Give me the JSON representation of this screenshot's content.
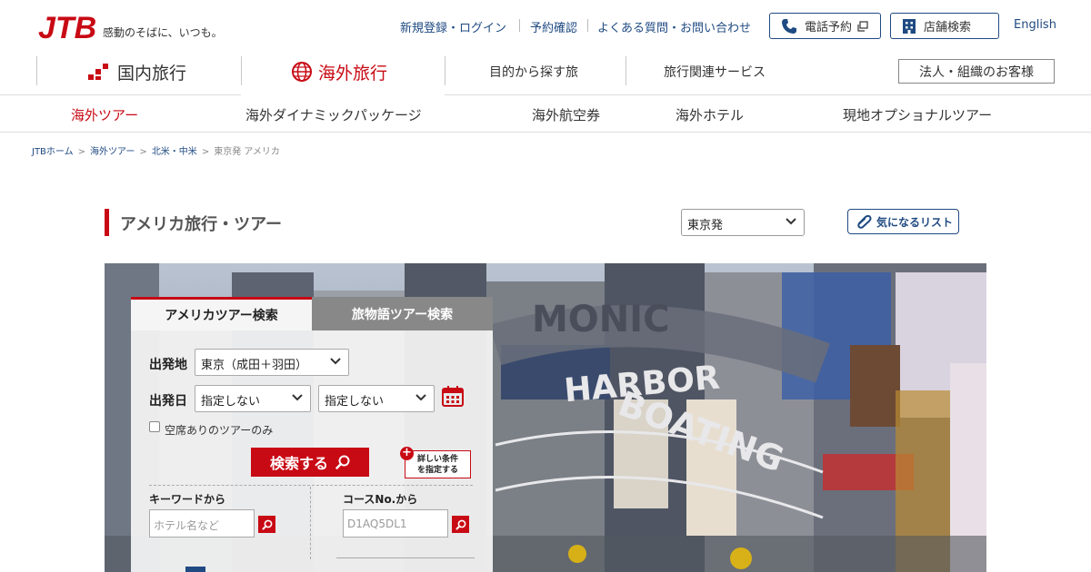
{
  "header": {
    "logo_text": "JTB",
    "tagline": "感動のそばに、いつも。",
    "links": [
      "新規登録・ログイン",
      "予約確認",
      "よくある質問・お問い合わせ"
    ],
    "phone_button": "電話予約",
    "store_button": "店舗検索",
    "english": "English"
  },
  "nav": {
    "domestic": "国内旅行",
    "overseas": "海外旅行",
    "purpose": "目的から探す旅",
    "services": "旅行関連サービス",
    "corporate": "法人・組織のお客様"
  },
  "subnav": [
    "海外ツアー",
    "海外ダイナミックパッケージ",
    "海外航空券",
    "海外ホテル",
    "現地オプショナルツアー"
  ],
  "breadcrumb": [
    "JTBホーム",
    "海外ツアー",
    "北米・中米",
    "東京発 アメリカ"
  ],
  "page": {
    "title": "アメリカ旅行・ツアー",
    "departure_select": "東京発",
    "favorites": "気になるリスト"
  },
  "search": {
    "tab_active": "アメリカツアー検索",
    "tab_inactive": "旅物語ツアー検索",
    "departure_label": "出発地",
    "departure_value": "東京（成田＋羽田）",
    "date_label": "出発日",
    "date_from": "指定しない",
    "date_to": "指定しない",
    "vacancy_only": "空席ありのツアーのみ",
    "search_button": "検索する",
    "detail_line1": "詳しい条件",
    "detail_line2": "を指定する",
    "keyword_label": "キーワードから",
    "keyword_placeholder": "ホテル名など",
    "course_label": "コースNo.から",
    "course_placeholder": "D1AQ5DL1"
  },
  "hero": {
    "sign1": "HARBOR",
    "sign2": "BOATING",
    "sign3": "MONIC"
  },
  "colors": {
    "accent": "#c80a14",
    "link": "#1f4a82"
  }
}
